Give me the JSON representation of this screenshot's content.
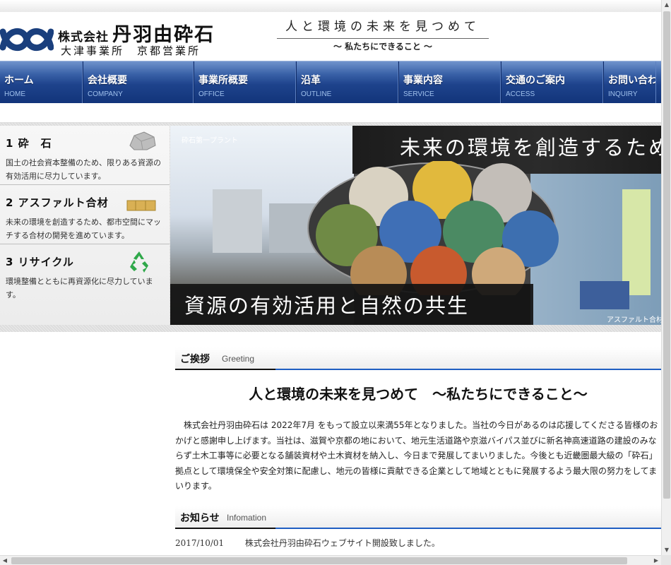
{
  "header": {
    "company_prefix": "株式会社",
    "company_name": "丹羽由砕石",
    "offices": "大津事業所　京都営業所",
    "slogan": "人と環境の未来を見つめて",
    "slogan_sub": "〜 私たちにできること 〜"
  },
  "nav": [
    {
      "label": "ホーム",
      "sub": "HOME"
    },
    {
      "label": "会社概要",
      "sub": "COMPANY"
    },
    {
      "label": "事業所概要",
      "sub": "OFFICE"
    },
    {
      "label": "沿革",
      "sub": "OUTLINE"
    },
    {
      "label": "事業内容",
      "sub": "SERVICE"
    },
    {
      "label": "交通のご案内",
      "sub": "ACCESS"
    },
    {
      "label": "お問い合わせ",
      "sub": "INQUIRY"
    }
  ],
  "features": [
    {
      "title": "1 砕　石",
      "text": "国土の社会資本整備のため、限りある資源の有効活用に尽力しています。",
      "icon": "crushed-stone-icon"
    },
    {
      "title": "2 アスファルト合材",
      "text": "未来の環境を創造するため、都市空間にマッチする合材の開発を進めています。",
      "icon": "asphalt-block-icon"
    },
    {
      "title": "3 リサイクル",
      "text": "環境整備とともに再資源化に尽力しています。",
      "icon": "recycle-icon"
    }
  ],
  "hero": {
    "label_left": "砕石第一プラント",
    "headline": "未来の環境を創造するため",
    "caption": "資源の有効活用と自然の共生",
    "label_right": "アスファルト合材"
  },
  "greeting": {
    "title": "ご挨拶",
    "sub": "Greeting",
    "heading": "人と環境の未来を見つめて　〜私たちにできること〜",
    "body": "株式会社丹羽由砕石は 2022年7月 をもって設立以来満55年となりました。当社の今日があるのは応援してくださる皆様のおかげと感謝申し上げます。当社は、滋賀や京都の地において、地元生活道路や京滋バイパス並びに新名神高速道路の建設のみならず土木工事等に必要となる舗装資材や土木資材を納入し、今日まで発展してまいりました。今後とも近畿圏最大級の「砕石」拠点として環境保全や安全対策に配慮し、地元の皆様に貢献できる企業として地域とともに発展するよう最大限の努力をしてまいります。"
  },
  "news": {
    "title": "お知らせ",
    "sub": "Infomation",
    "items": [
      {
        "date": "2017/10/01",
        "text": "株式会社丹羽由砕石ウェブサイト開設致しました。"
      }
    ]
  },
  "colors": {
    "nav_blue": "#1e438c",
    "accent_blue": "#1f5ec2",
    "logo_blue": "#1a3f7d"
  }
}
